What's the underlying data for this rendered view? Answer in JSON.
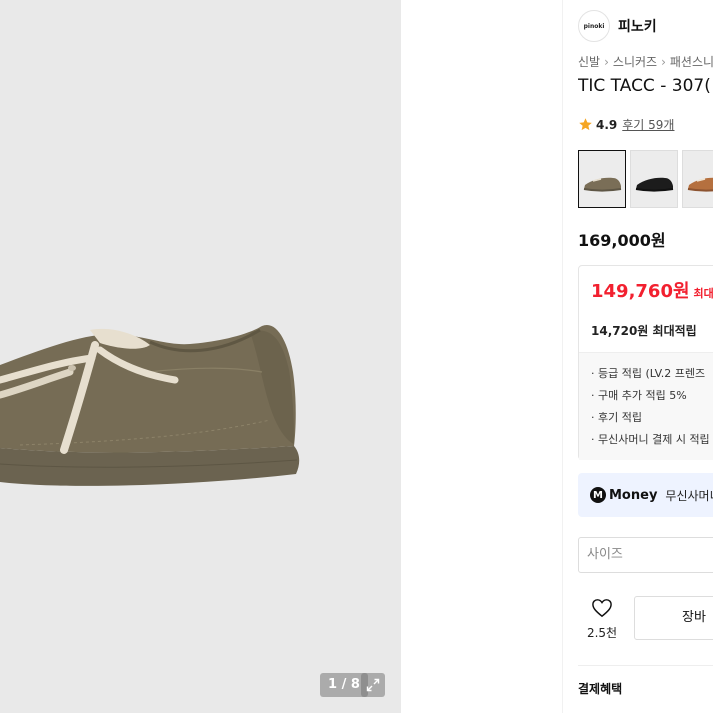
{
  "gallery": {
    "counter": "1 / 8",
    "current_image": 1,
    "total_images": 8,
    "image_alt": "olive suede sneaker"
  },
  "brand": {
    "logo_text": "pinoki",
    "name": "피노키"
  },
  "breadcrumb": [
    "신발",
    "스니커즈",
    "패션스니"
  ],
  "product": {
    "title": "TIC TACC - 307(",
    "rating": "4.9",
    "reviews": "후기 59개",
    "price": "169,000원"
  },
  "swatches": [
    {
      "name": "olive",
      "color": "#7a6e57",
      "selected": true
    },
    {
      "name": "black",
      "color": "#1c1c1c",
      "selected": false
    },
    {
      "name": "brown",
      "color": "#b5703f",
      "selected": false
    }
  ],
  "benefit": {
    "sale_price": "149,760원",
    "sale_label": "최대혜",
    "points": "14,720원 최대적립",
    "details": [
      "· 등급 적립 (LV.2 프렌즈",
      "· 구매 추가 적립 5%",
      "· 후기 적립",
      "· 무신사머니 결제 시 적립"
    ]
  },
  "money_banner": {
    "icon": "M",
    "word": "Money",
    "text": "무신사머니"
  },
  "size_select": {
    "placeholder": "사이즈"
  },
  "actions": {
    "like_count": "2.5천",
    "cart_label": "장바"
  },
  "section": {
    "payment_benefits": "결제혜택"
  },
  "colors": {
    "sale_red": "#f2202f",
    "star": "#f5a623",
    "money_bg": "#eef3ff"
  }
}
